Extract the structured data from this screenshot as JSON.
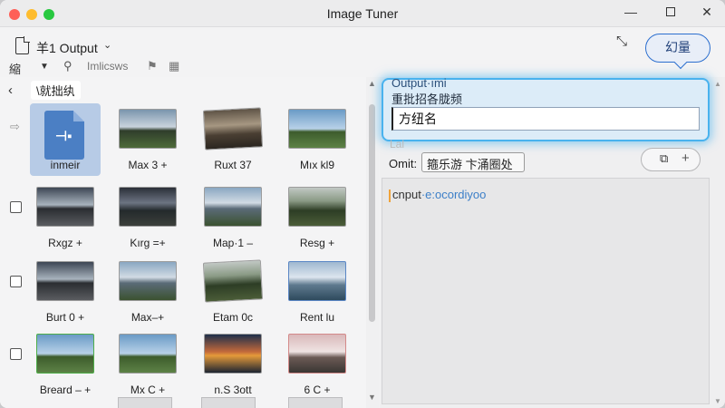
{
  "window": {
    "title": "Image Tuner",
    "minimize_icon": "minimize-icon",
    "maximize_icon": "maximize-icon",
    "close_icon": "close-icon"
  },
  "toolbar": {
    "file_title": "羊1  Output",
    "file_caret": "⌄",
    "sort_label": "縮序",
    "sort_caret": "▼",
    "search_placeholder": "Imlicsws",
    "run_label": "幻量"
  },
  "left": {
    "back": "‹",
    "folder_label": "\\就拙纨",
    "rows": [
      {
        "check": "tag",
        "items": [
          {
            "label": "inmeir",
            "scene": "file",
            "selected": true
          },
          {
            "label": "Max 3 +",
            "scene": "sky-dusk"
          },
          {
            "label": "Ruxt 37",
            "scene": "sky-arch",
            "tilt": true
          },
          {
            "label": "Mıx kl9",
            "scene": "sky-day"
          }
        ]
      },
      {
        "check": "box",
        "items": [
          {
            "label": "Rxgz +",
            "scene": "sky-road"
          },
          {
            "label": "Kırg =+",
            "scene": "sky-dark"
          },
          {
            "label": "Map·1 –",
            "scene": "sky-mtn"
          },
          {
            "label": "Resg +",
            "scene": "sky-forest"
          }
        ]
      },
      {
        "check": "box",
        "items": [
          {
            "label": "Burt 0 +",
            "scene": "sky-road"
          },
          {
            "label": "Max–+",
            "scene": "sky-mtn"
          },
          {
            "label": "Etam 0c",
            "scene": "sky-forest",
            "tilt": true
          },
          {
            "label": "Rent lu",
            "scene": "sky-lake",
            "border": "blue"
          }
        ]
      },
      {
        "check": "box",
        "items": [
          {
            "label": "Breard – +",
            "scene": "sky-day",
            "border": "green"
          },
          {
            "label": "Mx C +",
            "scene": "sky-day"
          },
          {
            "label": "n.S 3ott",
            "scene": "sky-sunset"
          },
          {
            "label": "6 C +",
            "scene": "sky-pink",
            "border": "pink"
          }
        ]
      }
    ]
  },
  "right": {
    "output_label": "Output·ımi",
    "output_sublabel": "重批招各胧频",
    "name_value": "方纽名",
    "faded_label": "Lal",
    "omit_label": "Omit:",
    "omit_value": "箍乐游 卞涌圈处",
    "copy_icon": "copy-icon",
    "plus": "+",
    "code_prefix": "cnput",
    "code_suffix": "·e:ocordiyoo"
  },
  "colors": {
    "accent": "#2c6fcf",
    "glow": "#49b2ee",
    "selection": "#b7cbe6"
  }
}
